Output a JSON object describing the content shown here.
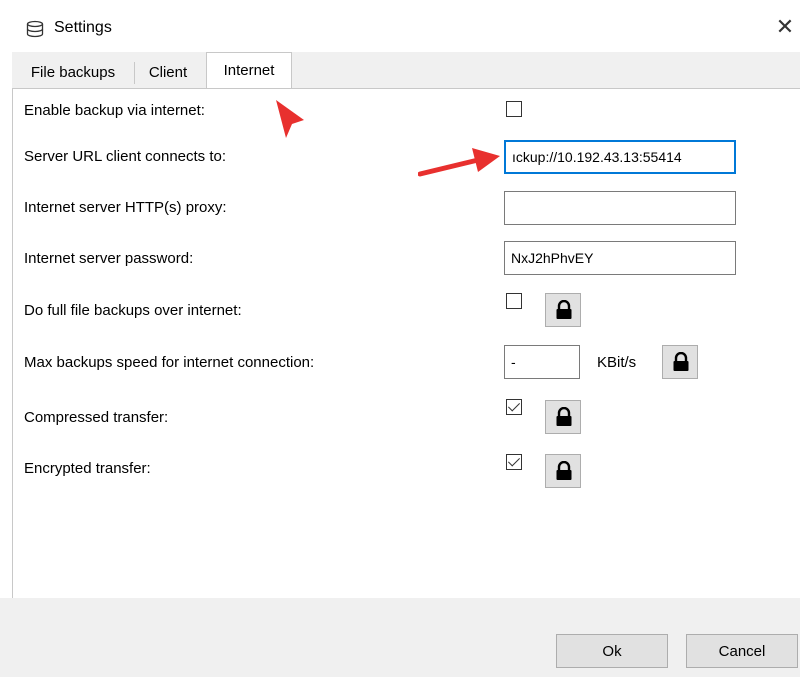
{
  "window": {
    "title": "Settings",
    "icon": "database-icon",
    "close_glyph": "✕"
  },
  "tabs": [
    {
      "label": "File backups",
      "active": false
    },
    {
      "label": "Client",
      "active": false
    },
    {
      "label": "Internet",
      "active": true
    }
  ],
  "settings": {
    "enable_backup": {
      "label": "Enable backup via internet:",
      "checked": false
    },
    "server_url": {
      "label": "Server URL client connects to:",
      "value": "ıckup://10.192.43.13:55414"
    },
    "http_proxy": {
      "label": "Internet server HTTP(s) proxy:",
      "value": ""
    },
    "password": {
      "label": "Internet server password:",
      "value": "NxJ2hPhvEY"
    },
    "full_backups": {
      "label": "Do full file backups over internet:",
      "checked": false
    },
    "max_speed": {
      "label": "Max backups speed for internet connection:",
      "value": "-",
      "unit": "KBit/s"
    },
    "compressed": {
      "label": "Compressed transfer:",
      "checked": true
    },
    "encrypted": {
      "label": "Encrypted transfer:",
      "checked": true
    }
  },
  "buttons": {
    "ok": "Ok",
    "cancel": "Cancel"
  },
  "colors": {
    "annotation_arrow": "#e8302e",
    "focus_border": "#0078d7"
  }
}
